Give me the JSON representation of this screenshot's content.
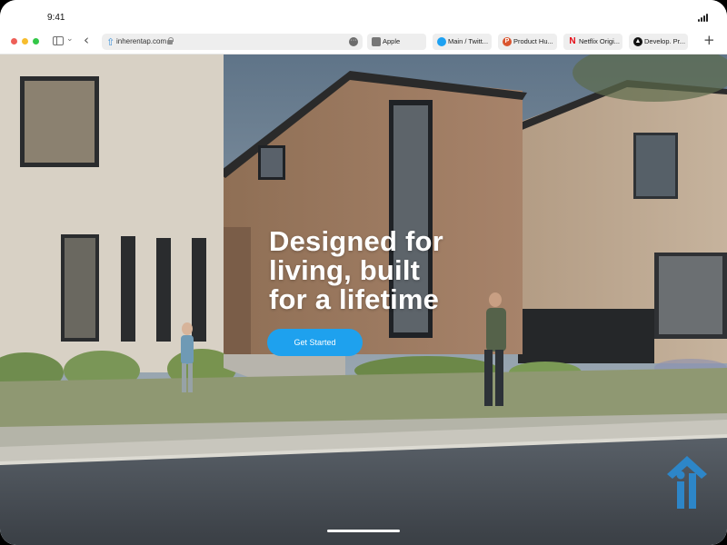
{
  "status": {
    "time": "9:41"
  },
  "browser": {
    "address": {
      "url": "inherentap.com"
    },
    "tabs": [
      {
        "label": "Apple",
        "icon": "apple-icon"
      },
      {
        "label": "Main / Twitt...",
        "icon": "twitter-icon"
      },
      {
        "label": "Product Hu...",
        "icon": "product-hunt-icon"
      },
      {
        "label": "Netflix Origi...",
        "icon": "netflix-icon"
      },
      {
        "label": "Develop. Pr...",
        "icon": "develop-icon"
      }
    ]
  },
  "hero": {
    "headline_line1": "Designed for",
    "headline_line2": "living, built",
    "headline_line3": "for a lifetime",
    "cta_label": "Get Started"
  },
  "colors": {
    "accent": "#1ea1ee",
    "logo": "#2d86c8",
    "traffic_red": "#ee5f58",
    "traffic_yellow": "#f7bd2e",
    "traffic_green": "#33c748"
  }
}
